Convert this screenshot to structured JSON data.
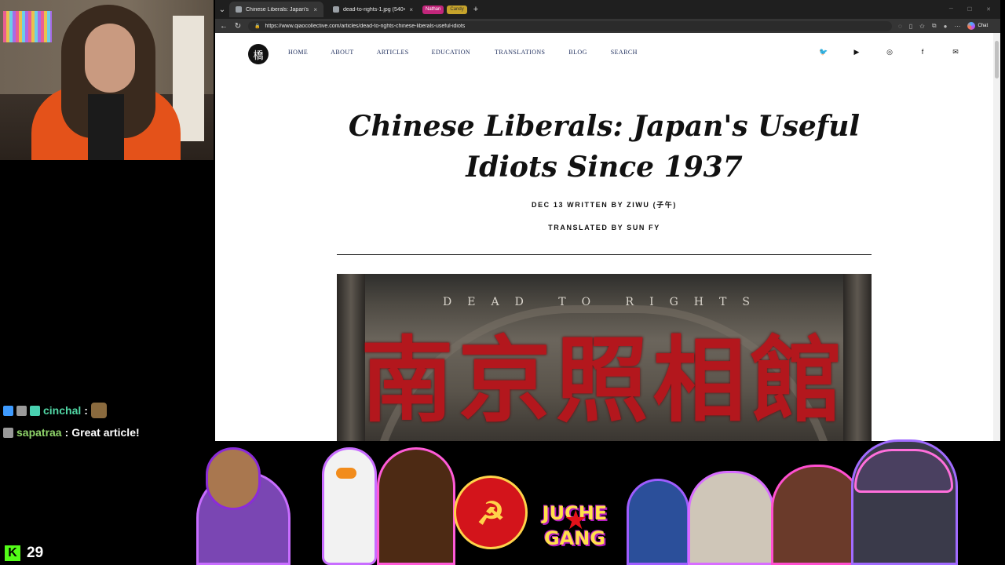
{
  "browser": {
    "tabs": [
      {
        "title": "Chinese Liberals: Japan's Useful Idiots Since 1937",
        "active": true
      },
      {
        "title": "dead-to-rights-1.jpg (540×357)",
        "active": false
      }
    ],
    "chips": [
      "Nathan",
      "Candy"
    ],
    "url": "https://www.qiaocollective.com/articles/dead-to-rights-chinese-liberals-useful-idiots",
    "chat_button": "Chat"
  },
  "site": {
    "logo_glyph": "橋",
    "menu": [
      "HOME",
      "ABOUT",
      "ARTICLES",
      "EDUCATION",
      "TRANSLATIONS",
      "BLOG",
      "SEARCH"
    ],
    "socials": [
      "twitter-icon",
      "youtube-icon",
      "instagram-icon",
      "facebook-icon",
      "mail-icon"
    ]
  },
  "article": {
    "title_line1": "Chinese Liberals: Japan's Useful",
    "title_line2": "Idiots Since 1937",
    "byline": "DEC 13   WRITTEN BY ZIWU (子午)",
    "translator": "TRANSLATED BY SUN FY",
    "hero_small": "DEAD TO RIGHTS",
    "hero_big": "南京照相館"
  },
  "chat": {
    "messages": [
      {
        "user": "cinchal",
        "text": ""
      },
      {
        "user": "sapatraa",
        "text": "Great article!"
      }
    ]
  },
  "viewers": {
    "count": "29",
    "platform_icon": "kick-logo-icon"
  },
  "banner": {
    "emblem_symbol": "☭",
    "juche_line1": "JUCHE",
    "juche_line2": "GANG"
  }
}
